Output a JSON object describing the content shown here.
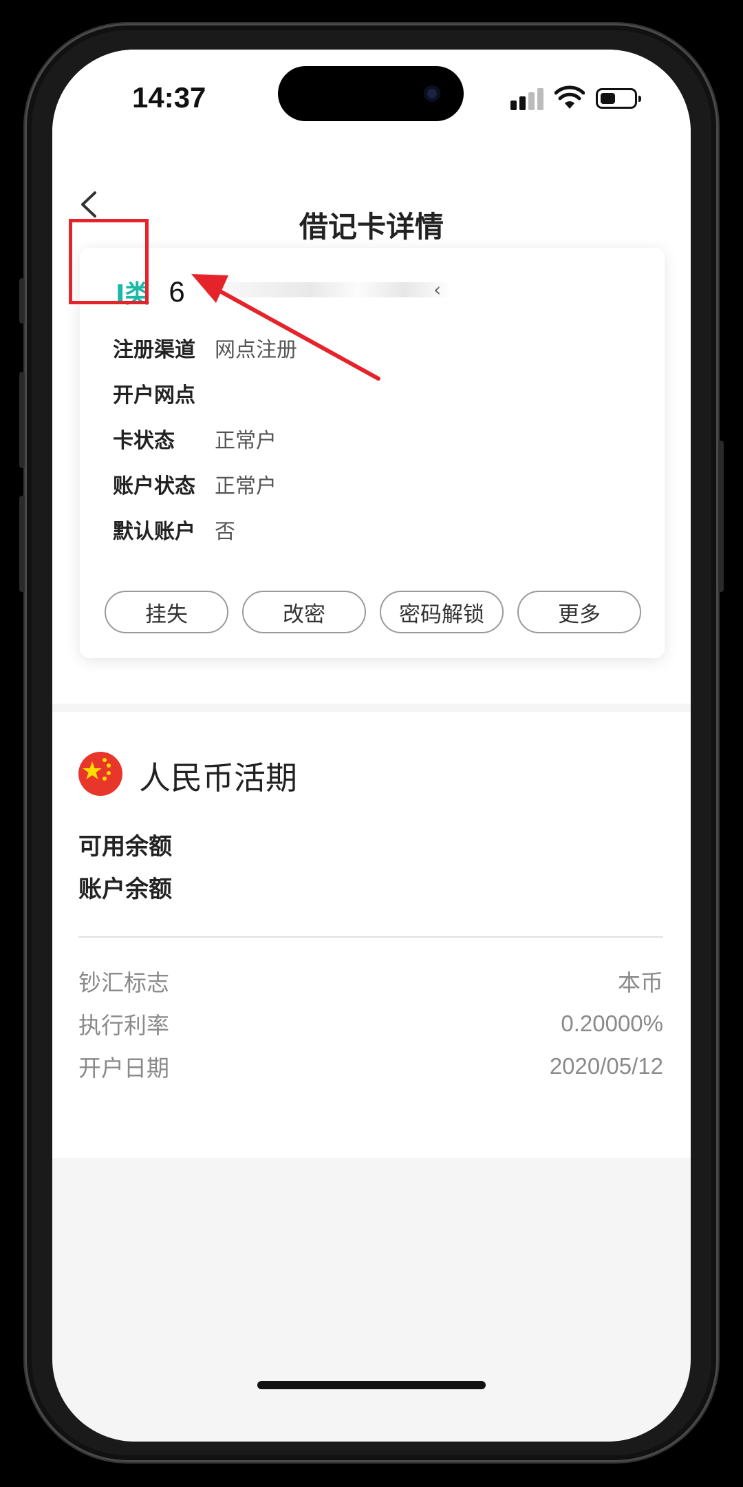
{
  "status_bar": {
    "time": "14:37",
    "battery_level": 0.45,
    "icons": [
      "signal-icon",
      "wifi-icon",
      "battery-icon"
    ]
  },
  "nav": {
    "title": "借记卡详情",
    "back_icon": "chevron-left-icon"
  },
  "card": {
    "type_label": "I类",
    "number_visible": "6",
    "rows": [
      {
        "label": "注册渠道",
        "value": "网点注册"
      },
      {
        "label": "开户网点",
        "value": ""
      },
      {
        "label": "卡状态",
        "value": "正常户"
      },
      {
        "label": "账户状态",
        "value": "正常户"
      },
      {
        "label": "默认账户",
        "value": "否"
      }
    ],
    "actions": [
      "挂失",
      "改密",
      "密码解锁",
      "更多"
    ]
  },
  "account": {
    "flag_icon": "china-flag-icon",
    "title": "人民币活期",
    "available_label": "可用余额",
    "balance_label": "账户余额",
    "meta": [
      {
        "label": "钞汇标志",
        "value": "本币"
      },
      {
        "label": "执行利率",
        "value": "0.20000%"
      },
      {
        "label": "开户日期",
        "value": "2020/05/12"
      }
    ]
  },
  "colors": {
    "accent_teal": "#19b8a8",
    "annotation_red": "#e5232a",
    "flag_red": "#e8362a",
    "flag_star": "#ffde00"
  }
}
